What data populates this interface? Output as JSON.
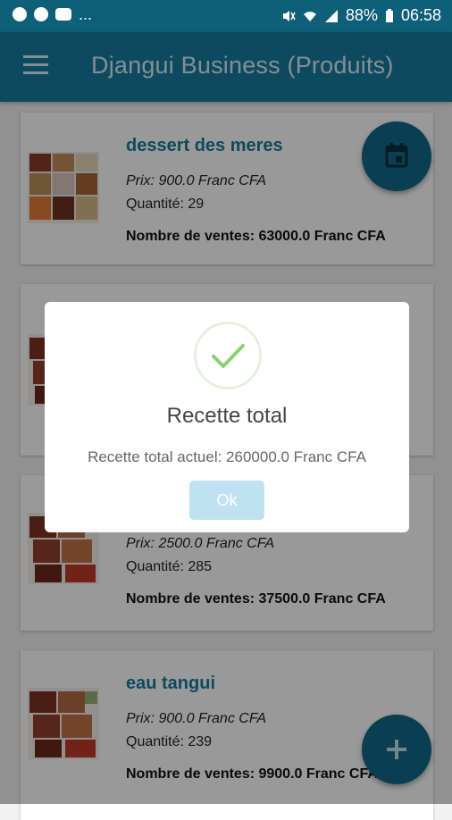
{
  "status_bar": {
    "battery": "88%",
    "time": "06:58",
    "more": "..."
  },
  "app_bar": {
    "title": "Djangui Business (Produits)"
  },
  "cards": [
    {
      "name": "dessert des meres",
      "price": "Prix: 900.0 Franc CFA",
      "qty": "Quantité: 29",
      "sales": "Nombre de ventes: 63000.0 Franc CFA"
    },
    {
      "name": "",
      "price": "",
      "qty": "",
      "sales": ""
    },
    {
      "name": "",
      "price": "Prix: 2500.0 Franc CFA",
      "qty": "Quantité: 285",
      "sales": "Nombre de ventes: 37500.0 Franc CFA"
    },
    {
      "name": "eau tangui",
      "price": "Prix: 900.0 Franc CFA",
      "qty": "Quantité: 239",
      "sales": "Nombre de ventes: 9900.0 Franc CFA"
    }
  ],
  "dialog": {
    "title": "Recette total",
    "message": "Recette total actuel: 260000.0 Franc CFA",
    "ok_label": "Ok"
  },
  "fab_icons": {
    "top": "calendar-icon",
    "bottom": "plus-icon"
  },
  "colors": {
    "primary": "#167c9f",
    "status_bar": "#0e5f7a",
    "fab": "#0f6a88",
    "ok_button": "#bfe2f2",
    "check": "#8fcf72"
  }
}
